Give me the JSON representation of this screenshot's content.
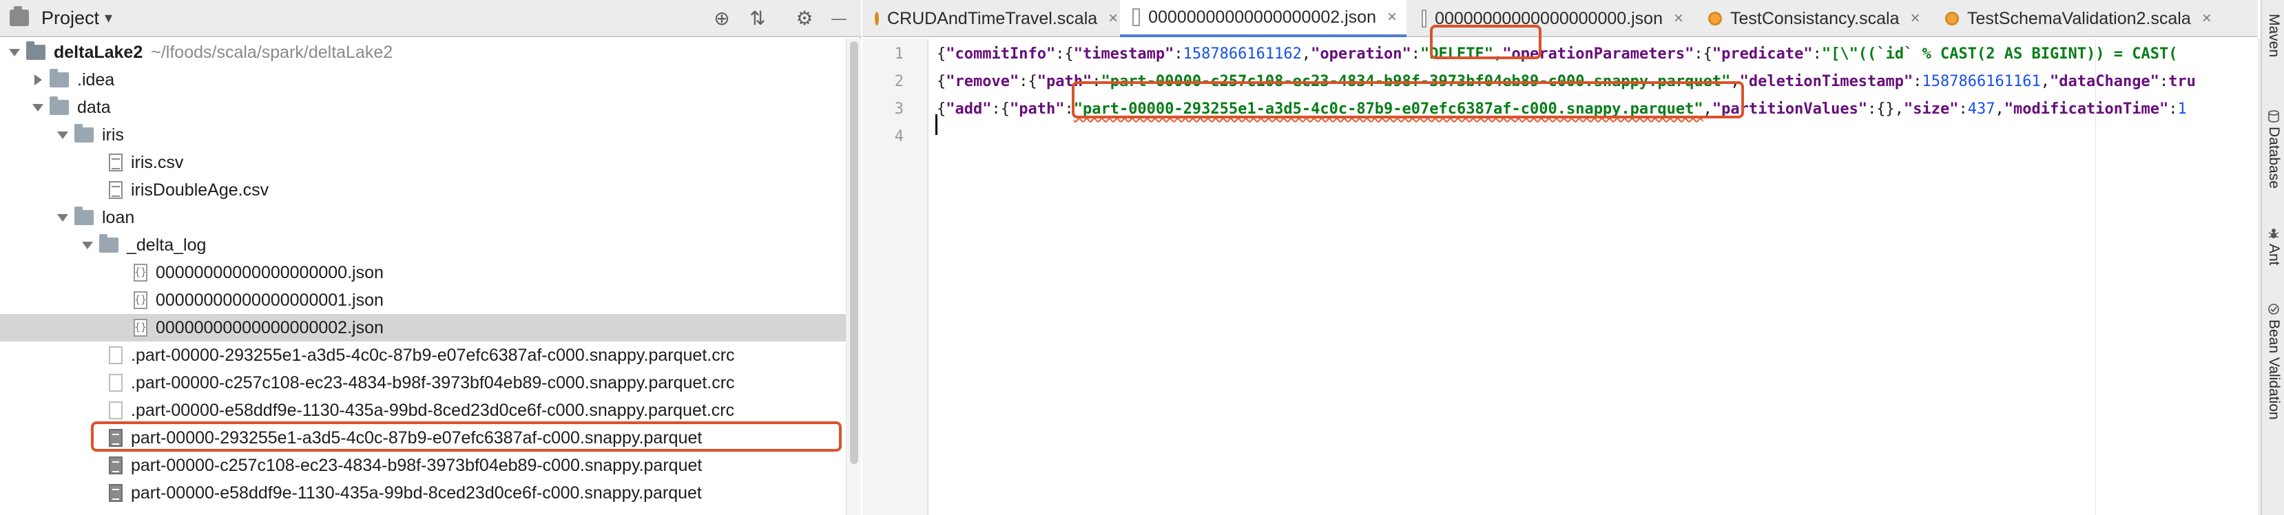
{
  "project_panel": {
    "title": "Project",
    "caret": "▾",
    "tools": [
      {
        "name": "crosshair-icon",
        "glyph": "⊕"
      },
      {
        "name": "collapse-icon",
        "glyph": "⇅"
      },
      {
        "name": "gear-icon",
        "glyph": "⚙"
      },
      {
        "name": "minimize-icon",
        "glyph": "—"
      }
    ],
    "root": {
      "name": "deltaLake2",
      "path": "~/lfoods/scala/spark/deltaLake2"
    },
    "tree": [
      {
        "label": "deltaLake2"
      },
      {
        "label": ".idea"
      },
      {
        "label": "data"
      },
      {
        "label": "iris"
      },
      {
        "label": "iris.csv"
      },
      {
        "label": "irisDoubleAge.csv"
      },
      {
        "label": "loan"
      },
      {
        "label": "_delta_log"
      },
      {
        "label": "00000000000000000000.json"
      },
      {
        "label": "00000000000000000001.json"
      },
      {
        "label": "00000000000000000002.json"
      },
      {
        "label": ".part-00000-293255e1-a3d5-4c0c-87b9-e07efc6387af-c000.snappy.parquet.crc"
      },
      {
        "label": ".part-00000-c257c108-ec23-4834-b98f-3973bf04eb89-c000.snappy.parquet.crc"
      },
      {
        "label": ".part-00000-e58ddf9e-1130-435a-99bd-8ced23d0ce6f-c000.snappy.parquet.crc"
      },
      {
        "label": "part-00000-293255e1-a3d5-4c0c-87b9-e07efc6387af-c000.snappy.parquet"
      },
      {
        "label": "part-00000-c257c108-ec23-4834-b98f-3973bf04eb89-c000.snappy.parquet"
      },
      {
        "label": "part-00000-e58ddf9e-1130-435a-99bd-8ced23d0ce6f-c000.snappy.parquet"
      }
    ]
  },
  "tabs": [
    {
      "label": "CRUDAndTimeTravel.scala",
      "type": "scala",
      "close": "×"
    },
    {
      "label": "00000000000000000002.json",
      "type": "json",
      "close": "×",
      "active": true
    },
    {
      "label": "00000000000000000000.json",
      "type": "json",
      "close": "×"
    },
    {
      "label": "TestConsistancy.scala",
      "type": "scala",
      "close": "×"
    },
    {
      "label": "TestSchemaValidation2.scala",
      "type": "scala",
      "close": "×"
    }
  ],
  "editor": {
    "line_numbers": [
      "1",
      "2",
      "3",
      "4"
    ],
    "lines": [
      {
        "t1": "{",
        "t2": "\"commitInfo\"",
        "t3": ":{",
        "t4": "\"timestamp\"",
        "t5": ":",
        "t6": "1587866161162",
        "t7": ",",
        "t8": "\"operation\"",
        "t9": ":",
        "t10": "\"DELETE\"",
        "t11": ",",
        "t12": "\"operationParameters\"",
        "t13": ":{",
        "t14": "\"predicate\"",
        "t15": ":",
        "t16": "\"[\\\"((`id` % CAST(2 AS BIGINT)) = CAST("
      },
      {
        "t1": "{",
        "t2": "\"remove\"",
        "t3": ":{",
        "t4": "\"path\"",
        "t5": ":",
        "t6": "\"part-00000-c257c108-ec23-4834-b98f-3973bf04eb89-c000.snappy.parquet\"",
        "t7": ",",
        "t8": "\"deletionTimestamp\"",
        "t9": ":",
        "t10": "1587866161161",
        "t11": ",",
        "t12": "\"dataChange\"",
        "t13": ":",
        "t14": "tru"
      },
      {
        "t1": "{",
        "t2": "\"add\"",
        "t3": ":{",
        "t4": "\"path\"",
        "t5": ":",
        "t6": "\"part-00000-293255e1-a3d5-4c0c-87b9-e07efc6387af-c000.snappy.parquet\"",
        "t7": ",",
        "t8": "\"partitionValues\"",
        "t9": ":{},",
        "t10": "\"size\"",
        "t11": ":",
        "t12": "437",
        "t13": ",",
        "t14": "\"modificationTime\"",
        "t15": ":",
        "t16": "1"
      }
    ]
  },
  "right_tools": [
    {
      "label": "Maven",
      "icon": "maven-icon"
    },
    {
      "label": "Database",
      "icon": "database-icon"
    },
    {
      "label": "Ant",
      "icon": "ant-icon"
    },
    {
      "label": "Bean Validation",
      "icon": "bean-validation-icon"
    }
  ],
  "colors": {
    "highlight": "#d9532c",
    "keyword": "#660e7a",
    "string": "#067d17",
    "number": "#1750eb",
    "selection": "#d5d5d5"
  }
}
